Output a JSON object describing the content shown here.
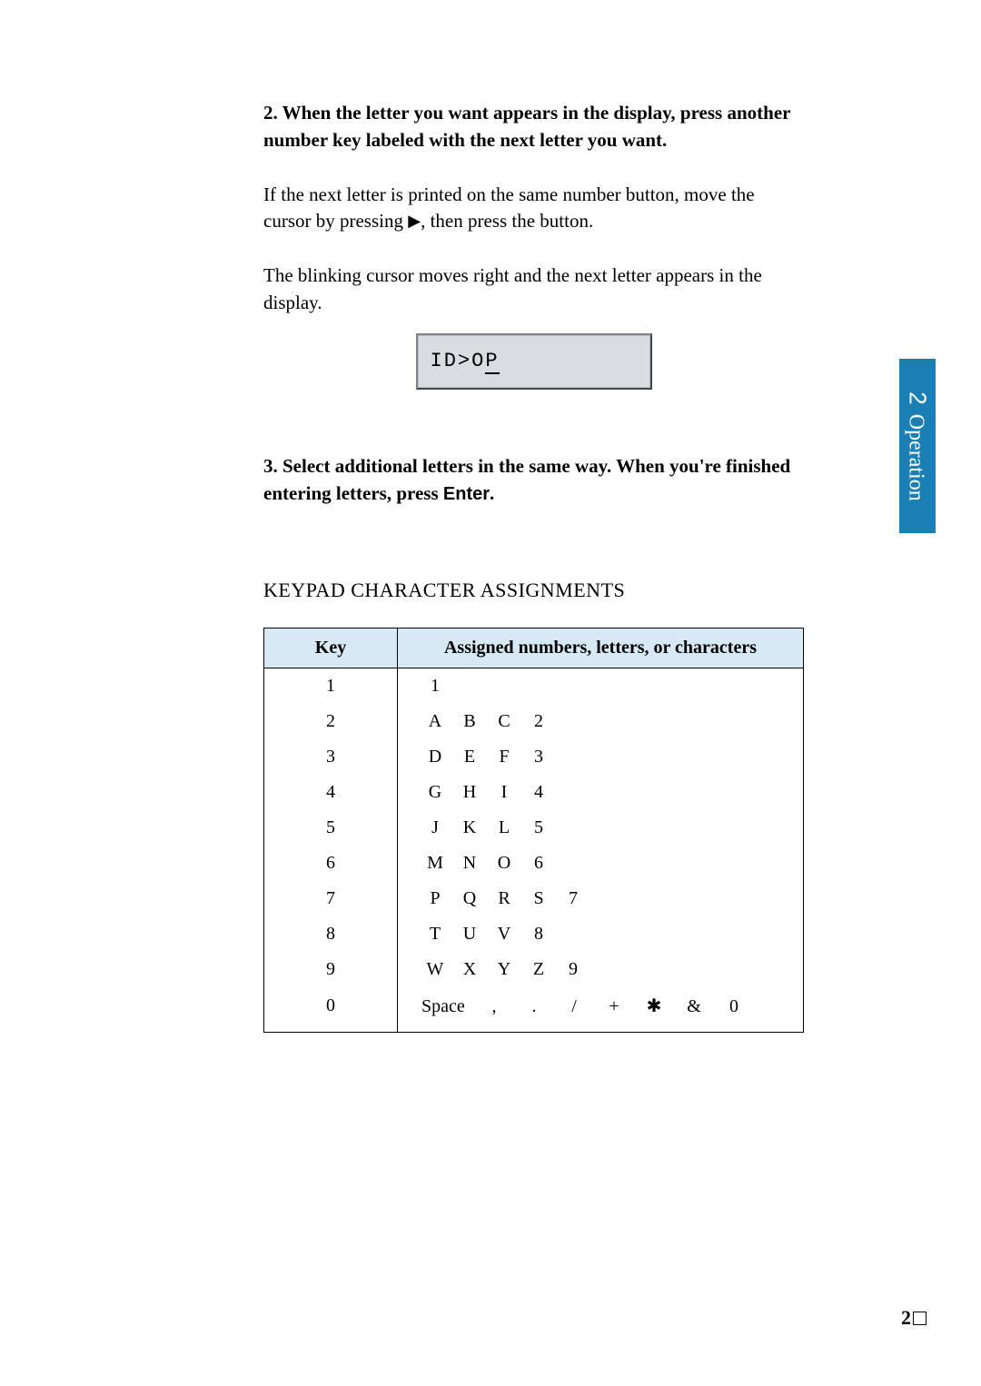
{
  "step2": {
    "bold": "2. When the letter you want appears in the display, press another number key labeled with the next letter you want.",
    "para1a": "If the next letter is printed on the same number button, move the cursor by pressing ",
    "arrow": "▶",
    "para1b": ", then press the button.",
    "para2": "The blinking cursor moves right and the next letter appears in the display."
  },
  "display": {
    "prefix": "ID>O",
    "cursor_char": "P"
  },
  "step3": {
    "bold_a": "3. Select additional letters in the same way. When you're finished entering letters, press ",
    "enter": "Enter",
    "bold_b": "."
  },
  "section_heading": "KEYPAD CHARACTER ASSIGNMENTS",
  "table": {
    "head_key": "Key",
    "head_val": "Assigned numbers, letters, or characters",
    "rows": [
      {
        "key": "1",
        "chars": [
          "1"
        ]
      },
      {
        "key": "2",
        "chars": [
          "A",
          "B",
          "C",
          "2"
        ]
      },
      {
        "key": "3",
        "chars": [
          "D",
          "E",
          "F",
          "3"
        ]
      },
      {
        "key": "4",
        "chars": [
          "G",
          "H",
          "I",
          "4"
        ]
      },
      {
        "key": "5",
        "chars": [
          "J",
          "K",
          "L",
          "5"
        ]
      },
      {
        "key": "6",
        "chars": [
          "M",
          "N",
          "O",
          "6"
        ]
      },
      {
        "key": "7",
        "chars": [
          "P",
          "Q",
          "R",
          "S",
          "7"
        ]
      },
      {
        "key": "8",
        "chars": [
          "T",
          "U",
          "V",
          "8"
        ]
      },
      {
        "key": "9",
        "chars": [
          "W",
          "X",
          "Y",
          "Z",
          "9"
        ]
      },
      {
        "key": "0",
        "chars": [
          "Space",
          ",",
          ".",
          "/",
          "+",
          "✱",
          "&",
          "0"
        ]
      }
    ]
  },
  "side_tab": {
    "num": "2",
    "label": "Operation"
  },
  "page_number": "2"
}
